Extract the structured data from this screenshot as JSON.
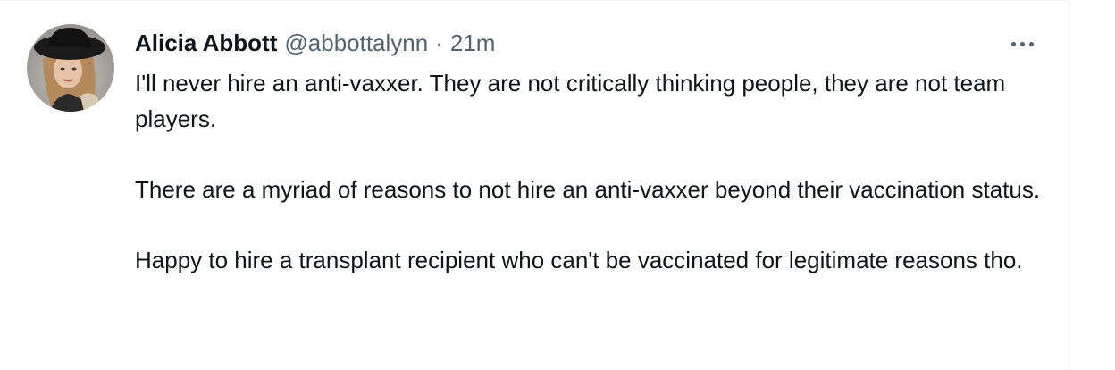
{
  "tweet": {
    "author": {
      "display_name": "Alicia Abbott",
      "handle": "@abbottalynn",
      "avatar_icon": "profile-photo"
    },
    "separator": "·",
    "time": "21m",
    "more_icon": "more-horizontal-icon",
    "paragraphs": [
      "I'll never hire an anti-vaxxer. They are not critically thinking people, they are not team players.",
      "There are a myriad of reasons to not hire an anti-vaxxer beyond their vaccination status.",
      "Happy to hire a transplant recipient who can't be vaccinated for legitimate reasons tho."
    ]
  },
  "colors": {
    "text_primary": "#0f1419",
    "text_secondary": "#536471",
    "border": "#eff3f4",
    "background": "#ffffff"
  }
}
